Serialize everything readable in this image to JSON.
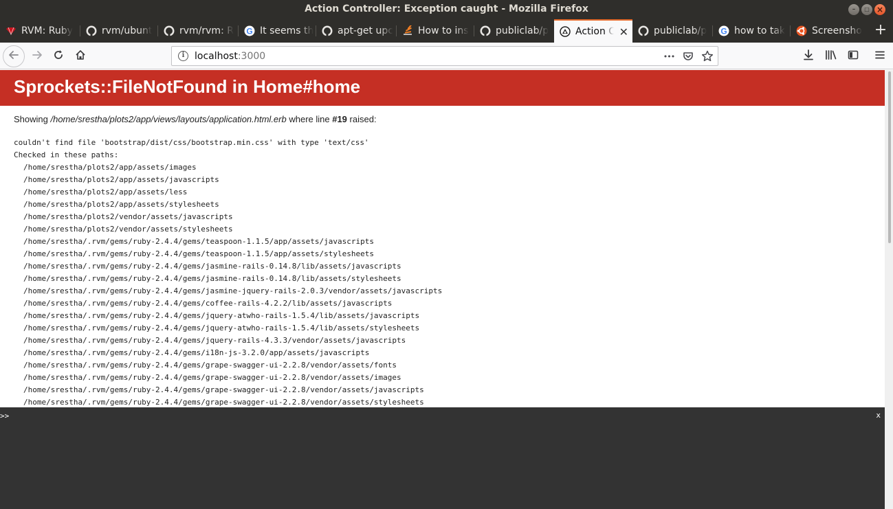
{
  "window": {
    "title": "Action Controller: Exception caught - Mozilla Firefox",
    "minimize_glyph": "–",
    "maximize_glyph": "□",
    "close_glyph": "×"
  },
  "tabs": [
    {
      "label": "RVM: Ruby",
      "icon": "rvm-icon",
      "active": false
    },
    {
      "label": "rvm/ubunt",
      "icon": "github-icon",
      "active": false
    },
    {
      "label": "rvm/rvm: R",
      "icon": "github-icon",
      "active": false
    },
    {
      "label": "It seems th",
      "icon": "google-icon",
      "active": false
    },
    {
      "label": "apt-get upc",
      "icon": "github-icon",
      "active": false
    },
    {
      "label": "How to ins",
      "icon": "stackexchange-icon",
      "active": false
    },
    {
      "label": "publiclab/p",
      "icon": "github-icon",
      "active": false
    },
    {
      "label": "Action C",
      "icon": "rails-icon",
      "active": true
    },
    {
      "label": "publiclab/p",
      "icon": "github-icon",
      "active": false
    },
    {
      "label": "how to tak",
      "icon": "google-icon",
      "active": false
    },
    {
      "label": "Screensho",
      "icon": "ubuntu-icon",
      "active": false
    }
  ],
  "new_tab_label": "+",
  "close_tab_glyph": "✕",
  "urlbar": {
    "host": "localhost",
    "port": ":3000",
    "info_glyph": "i",
    "more_glyph": "•••"
  },
  "page": {
    "heading": "Sprockets::FileNotFound in Home#home",
    "showing_prefix": "Showing ",
    "showing_path": "/home/srestha/plots2/app/views/layouts/application.html.erb",
    "showing_mid": " where line ",
    "showing_line": "#19",
    "showing_suffix": " raised:",
    "error_message": "couldn't find file 'bootstrap/dist/css/bootstrap.min.css' with type 'text/css'",
    "checked_label": "Checked in these paths:",
    "paths": [
      "/home/srestha/plots2/app/assets/images",
      "/home/srestha/plots2/app/assets/javascripts",
      "/home/srestha/plots2/app/assets/less",
      "/home/srestha/plots2/app/assets/stylesheets",
      "/home/srestha/plots2/vendor/assets/javascripts",
      "/home/srestha/plots2/vendor/assets/stylesheets",
      "/home/srestha/.rvm/gems/ruby-2.4.4/gems/teaspoon-1.1.5/app/assets/javascripts",
      "/home/srestha/.rvm/gems/ruby-2.4.4/gems/teaspoon-1.1.5/app/assets/stylesheets",
      "/home/srestha/.rvm/gems/ruby-2.4.4/gems/jasmine-rails-0.14.8/lib/assets/javascripts",
      "/home/srestha/.rvm/gems/ruby-2.4.4/gems/jasmine-rails-0.14.8/lib/assets/stylesheets",
      "/home/srestha/.rvm/gems/ruby-2.4.4/gems/jasmine-jquery-rails-2.0.3/vendor/assets/javascripts",
      "/home/srestha/.rvm/gems/ruby-2.4.4/gems/coffee-rails-4.2.2/lib/assets/javascripts",
      "/home/srestha/.rvm/gems/ruby-2.4.4/gems/jquery-atwho-rails-1.5.4/lib/assets/javascripts",
      "/home/srestha/.rvm/gems/ruby-2.4.4/gems/jquery-atwho-rails-1.5.4/lib/assets/stylesheets",
      "/home/srestha/.rvm/gems/ruby-2.4.4/gems/jquery-rails-4.3.3/vendor/assets/javascripts",
      "/home/srestha/.rvm/gems/ruby-2.4.4/gems/i18n-js-3.2.0/app/assets/javascripts",
      "/home/srestha/.rvm/gems/ruby-2.4.4/gems/grape-swagger-ui-2.2.8/vendor/assets/fonts",
      "/home/srestha/.rvm/gems/ruby-2.4.4/gems/grape-swagger-ui-2.2.8/vendor/assets/images",
      "/home/srestha/.rvm/gems/ruby-2.4.4/gems/grape-swagger-ui-2.2.8/vendor/assets/javascripts",
      "/home/srestha/.rvm/gems/ruby-2.4.4/gems/grape-swagger-ui-2.2.8/vendor/assets/stylesheets"
    ]
  },
  "console": {
    "prompt": ">>",
    "close_label": "x"
  },
  "colors": {
    "header_red": "#c52f24",
    "active_tab_accent": "#e66a2b",
    "console_bg": "#333333",
    "titlebar_bg": "#2f2e2b"
  }
}
